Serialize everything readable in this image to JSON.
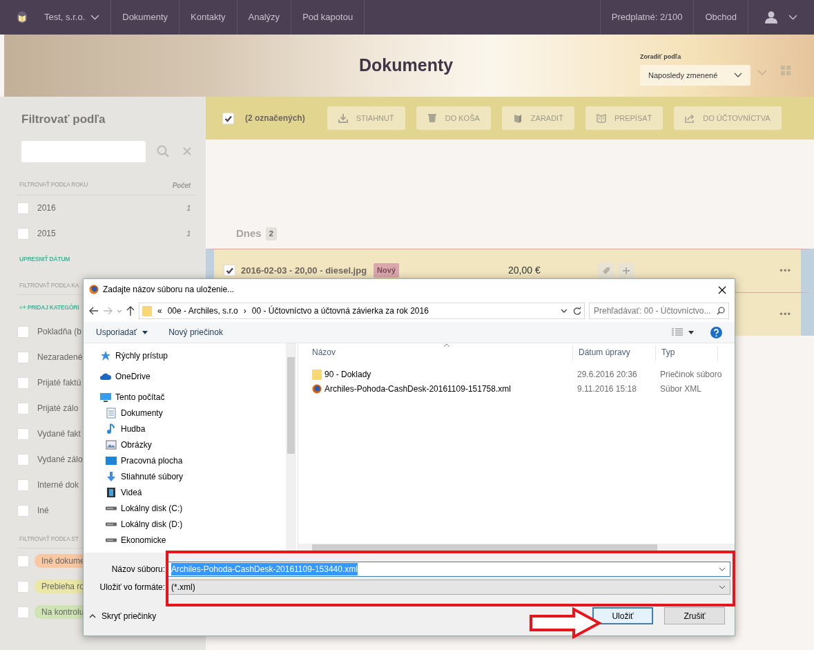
{
  "navbar": {
    "company": "Test, s.r.o.",
    "links": [
      "Dokumenty",
      "Kontakty",
      "Analýzy",
      "Pod kapotou"
    ],
    "subscription": "Predplatné: 2/100",
    "shop": "Obchod"
  },
  "header": {
    "title": "Dokumenty",
    "sort_label": "Zoradiť podľa",
    "sort_value": "Naposledy zmenené"
  },
  "sidebar": {
    "title": "Filtrovať podľa",
    "blocks": [
      {
        "kind": "heading",
        "label": "FILTROVAŤ PODĽA ROKU",
        "count_heading": "Počet"
      },
      {
        "kind": "check",
        "label": "2016",
        "count": "1",
        "checked": false
      },
      {
        "kind": "check",
        "label": "2015",
        "count": "1",
        "checked": false
      },
      {
        "kind": "link",
        "label": "UPRESNIŤ DÁTUM"
      },
      {
        "kind": "heading",
        "label": "FILTROVAŤ PODĽA KA"
      },
      {
        "kind": "link",
        "label": "≡+ PRIDAJ KATEGÓRI"
      },
      {
        "kind": "check",
        "label": "Pokladňa (b",
        "checked": false
      },
      {
        "kind": "check",
        "label": "Nezaradené",
        "checked": false
      },
      {
        "kind": "check",
        "label": "Prijaté faktú",
        "checked": false
      },
      {
        "kind": "check",
        "label": "Prijaté zálo",
        "checked": false
      },
      {
        "kind": "check",
        "label": "Vydané fakt",
        "checked": false
      },
      {
        "kind": "check",
        "label": "Vydané zálo",
        "checked": false
      },
      {
        "kind": "check",
        "label": "Interné dok",
        "checked": false
      },
      {
        "kind": "check",
        "label": "Iné",
        "checked": false
      },
      {
        "kind": "heading",
        "label": "FILTROVAŤ PODĽA ST"
      },
      {
        "kind": "tag",
        "label": "Iné dokume",
        "checked": false,
        "color": "#f8c8a4"
      },
      {
        "kind": "tag",
        "label": "Prebieha ro",
        "checked": false,
        "color": "#ebe8a6"
      },
      {
        "kind": "tag",
        "label": "Na kontrolu",
        "checked": false,
        "color": "#cfe4b4"
      }
    ]
  },
  "toolbar": {
    "select_all": true,
    "selection": "(2 označených)",
    "actions": [
      "STIAHNUŤ",
      "DO KOŠA",
      "ZARADIŤ",
      "PREPÍSAŤ",
      "DO ÚČTOVNÍCTVA"
    ]
  },
  "documents": {
    "group": "Dnes",
    "group_count": "2",
    "rows": [
      {
        "checked": true,
        "title": "2016-02-03 - 20,00 - diesel.jpg",
        "badge": "Nový",
        "amount": "20,00 €",
        "menu": "•••"
      },
      {
        "menu": "•••"
      }
    ]
  },
  "dialog": {
    "title": "Zadajte názov súboru na uloženie...",
    "breadcrumb": [
      "«",
      "00e - Archiles, s.r.o",
      "›",
      "00 - Účtovníctvo a účtovná závierka za rok 2016"
    ],
    "search_placeholder": "Prehľadávať: 00 - Účtovníctvo...",
    "organize": "Usporiadať",
    "new_folder": "Nový priečinok",
    "tree": [
      {
        "label": "Rýchly prístup"
      },
      {
        "label": "OneDrive"
      },
      {
        "label": "Tento počítač",
        "children": [
          {
            "label": "Dokumenty"
          },
          {
            "label": "Hudba"
          },
          {
            "label": "Obrázky"
          },
          {
            "label": "Pracovná plocha"
          },
          {
            "label": "Stiahnuté súbory"
          },
          {
            "label": "Videá"
          },
          {
            "label": "Lokálny disk (C:)"
          },
          {
            "label": "Lokálny disk (D:)"
          },
          {
            "label": "Ekonomicke"
          }
        ]
      }
    ],
    "columns": [
      "Názov",
      "Dátum úpravy",
      "Typ"
    ],
    "files": [
      {
        "kind": "folder",
        "name": "90 - Doklady",
        "date": "29.6.2016 20:36",
        "type": "Priečinok súboro"
      },
      {
        "kind": "xml",
        "name": "Archiles-Pohoda-CashDesk-20161109-151758.xml",
        "date": "9.11.2016 15:18",
        "type": "Súbor XML"
      }
    ],
    "filename_label": "Názov súboru:",
    "filename": "Archiles-Pohoda-CashDesk-20161109-153440.xml",
    "format_label": "Uložiť vo formáte:",
    "format": "(*.xml)",
    "hide_folders": "Skryť priečinky",
    "buttons": [
      {
        "label": "Uložiť",
        "default": true
      },
      {
        "label": "Zrušiť",
        "default": false
      }
    ]
  }
}
